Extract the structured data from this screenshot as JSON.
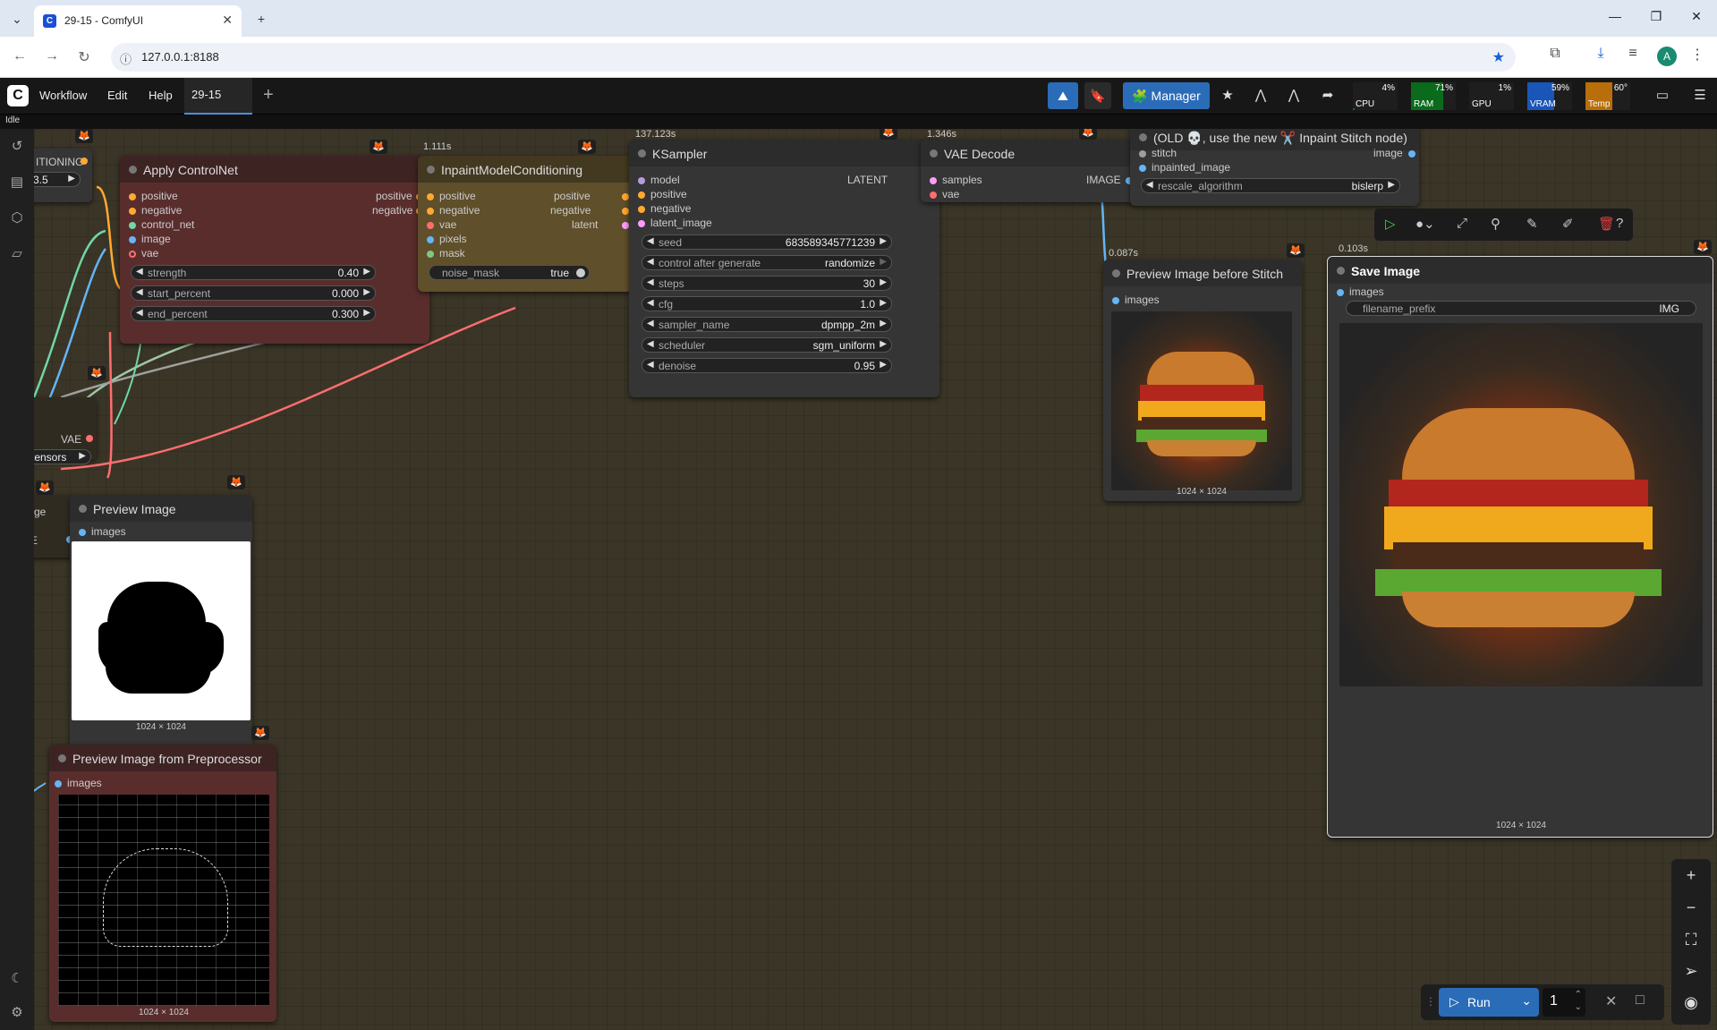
{
  "browser": {
    "tab_title": "29-15 - ComfyUI",
    "url": "127.0.0.1:8188",
    "avatar": "A"
  },
  "menubar": {
    "items": [
      "Workflow",
      "Edit",
      "Help"
    ],
    "workflow_tab": "29-15",
    "manager_label": "Manager"
  },
  "monitor": {
    "cpu": {
      "label": "CPU",
      "value": "4%"
    },
    "ram": {
      "label": "RAM",
      "value": "71%"
    },
    "gpu": {
      "label": "GPU",
      "value": "1%"
    },
    "vram": {
      "label": "VRAM",
      "value": "59%"
    },
    "temp": {
      "label": "Temp",
      "value": "60°"
    }
  },
  "status": "Idle",
  "nodes": {
    "cond_partial": {
      "out_label": "ITIONING",
      "value": "3.5"
    },
    "vae_loader": {
      "out_label": "VAE",
      "value": "tensors"
    },
    "apply_controlnet": {
      "title": "Apply ControlNet",
      "inputs": [
        "positive",
        "negative",
        "control_net",
        "image",
        "vae"
      ],
      "outputs": [
        "positive",
        "negative"
      ],
      "widgets": [
        {
          "name": "strength",
          "value": "0.40"
        },
        {
          "name": "start_percent",
          "value": "0.000"
        },
        {
          "name": "end_percent",
          "value": "0.300"
        }
      ]
    },
    "inpaint_cond": {
      "title": "InpaintModelConditioning",
      "time": "1.111s",
      "inputs": [
        "positive",
        "negative",
        "vae",
        "pixels",
        "mask"
      ],
      "outputs": [
        "positive",
        "negative",
        "latent"
      ],
      "toggle": {
        "name": "noise_mask",
        "value": "true"
      }
    },
    "ksampler": {
      "title": "KSampler",
      "time": "137.123s",
      "inputs": [
        "model",
        "positive",
        "negative",
        "latent_image"
      ],
      "output": "LATENT",
      "widgets": [
        {
          "name": "seed",
          "value": "683589345771239"
        },
        {
          "name": "control after generate",
          "value": "randomize"
        },
        {
          "name": "steps",
          "value": "30"
        },
        {
          "name": "cfg",
          "value": "1.0"
        },
        {
          "name": "sampler_name",
          "value": "dpmpp_2m"
        },
        {
          "name": "scheduler",
          "value": "sgm_uniform"
        },
        {
          "name": "denoise",
          "value": "0.95"
        }
      ]
    },
    "vae_decode": {
      "title": "VAE Decode",
      "time": "1.346s",
      "inputs": [
        "samples",
        "vae"
      ],
      "output": "IMAGE"
    },
    "stitch": {
      "title": "(OLD 💀, use the new ✂️ Inpaint Stitch node)",
      "inputs": [
        "stitch",
        "inpainted_image"
      ],
      "output": "image",
      "widget": {
        "name": "rescale_algorithm",
        "value": "bislerp"
      }
    },
    "preview_before": {
      "title": "Preview Image before Stitch",
      "time": "0.087s",
      "input": "images",
      "dims": "1024 × 1024"
    },
    "save_image": {
      "title": "Save Image",
      "time": "0.103s",
      "input": "images",
      "widget": {
        "name": "filename_prefix",
        "value": "IMG"
      },
      "dims": "1024 × 1024"
    },
    "preview_image": {
      "title": "Preview Image",
      "input": "images",
      "dims": "1024 × 1024",
      "left_partial_top": "ge",
      "left_partial_out": "E"
    },
    "preview_pre": {
      "title": "Preview Image from Preprocessor",
      "input": "images",
      "dims": "1024 × 1024"
    }
  },
  "runbar": {
    "run_label": "Run",
    "count": "1"
  },
  "colors": {
    "canvas_bg": "#3a3527",
    "accent": "#2b6cb8",
    "conditioning": "#ffa931",
    "control_net": "#6fd6a8",
    "image": "#64b5f6",
    "vae": "#ff6e6e",
    "latent": "#ff9cf9",
    "mask": "#81c784",
    "model": "#b39ddb"
  }
}
